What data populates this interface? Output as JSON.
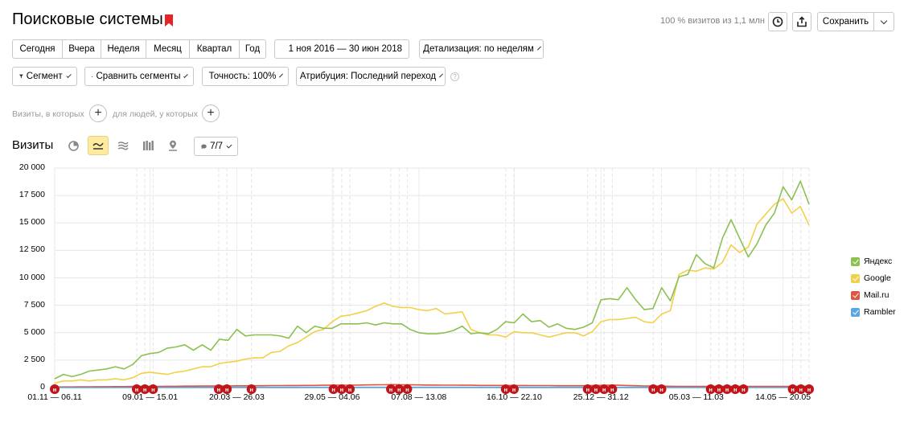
{
  "header": {
    "title": "Поисковые системы",
    "visits_total": "100 % визитов из 1,1 млн",
    "save_label": "Сохранить"
  },
  "period_buttons": [
    "Сегодня",
    "Вчера",
    "Неделя",
    "Месяц",
    "Квартал",
    "Год"
  ],
  "date_range": "1 ноя 2016 — 30 июн 2018",
  "detalization": "Детализация: по неделям",
  "filters": {
    "segment": "Сегмент",
    "compare": "Сравнить сегменты",
    "accuracy": "Точность: 100%",
    "attribution": "Атрибуция: Последний переход"
  },
  "conditions": {
    "visits_label": "Визиты, в которых",
    "people_label": "для людей, у которых"
  },
  "chart_panel": {
    "title": "Визиты",
    "annotations": "7/7"
  },
  "colors": {
    "yandex": "#8cc152",
    "google": "#f2d04a",
    "mailru": "#e0553f",
    "rambler": "#5aa6e0",
    "marker": "#c0161b"
  },
  "chart_data": {
    "type": "line",
    "ylim": [
      0,
      20000
    ],
    "yticks": [
      "20 000",
      "17 500",
      "15 000",
      "12 500",
      "10 000",
      "7 500",
      "5 000",
      "2 500",
      "0"
    ],
    "xtick_labels": [
      "01.11 — 06.11",
      "09.01 — 15.01",
      "20.03 — 26.03",
      "29.05 — 04.06",
      "07.08 — 13.08",
      "16.10 — 22.10",
      "25.12 — 31.12",
      "05.03 — 11.03",
      "14.05 — 20.05"
    ],
    "legend_position": "right",
    "series": [
      {
        "name": "Яндекс",
        "values": [
          800,
          1200,
          1000,
          1200,
          1500,
          1600,
          1700,
          1900,
          1700,
          2100,
          2900,
          3100,
          3200,
          3600,
          3700,
          3900,
          3400,
          3900,
          3400,
          4400,
          4300,
          5300,
          4700,
          4800,
          4800,
          4800,
          4700,
          4500,
          5600,
          5000,
          5600,
          5400,
          5400,
          5800,
          5800,
          5800,
          5900,
          5700,
          5900,
          5800,
          5800,
          5300,
          5000,
          4900,
          4900,
          5000,
          5200,
          5600,
          4900,
          5000,
          4900,
          5300,
          6000,
          5900,
          6700,
          6000,
          6100,
          5500,
          5800,
          5400,
          5300,
          5500,
          5900,
          8000,
          8100,
          8000,
          9100,
          8000,
          7100,
          7200,
          9100,
          7900,
          10100,
          10300,
          12100,
          11300,
          10900,
          13600,
          15300,
          13600,
          11900,
          13100,
          14800,
          15900,
          18300,
          17100,
          18800,
          16700
        ]
      },
      {
        "name": "Google",
        "values": [
          400,
          600,
          600,
          700,
          600,
          700,
          700,
          800,
          700,
          900,
          1300,
          1400,
          1300,
          1200,
          1400,
          1500,
          1700,
          1900,
          1900,
          2200,
          2300,
          2400,
          2600,
          2700,
          2700,
          3200,
          3300,
          3800,
          4100,
          4600,
          5100,
          5300,
          6000,
          6500,
          6600,
          6800,
          7000,
          7400,
          7700,
          7400,
          7300,
          7300,
          7100,
          7000,
          7200,
          6700,
          6800,
          6900,
          5300,
          5000,
          4800,
          4800,
          4600,
          5100,
          5000,
          5000,
          4800,
          4600,
          4800,
          5000,
          5000,
          4700,
          5100,
          6000,
          6200,
          6200,
          6300,
          6400,
          6000,
          5900,
          6700,
          7000,
          10300,
          10700,
          10600,
          10900,
          10800,
          11400,
          13000,
          12300,
          12800,
          14900,
          15800,
          16700,
          17200,
          15900,
          16500,
          14800
        ]
      },
      {
        "name": "Mail.ru",
        "values": [
          50,
          60,
          60,
          70,
          70,
          80,
          80,
          90,
          90,
          100,
          110,
          110,
          110,
          120,
          120,
          130,
          130,
          140,
          140,
          150,
          150,
          160,
          160,
          170,
          170,
          180,
          180,
          190,
          190,
          200,
          200,
          210,
          210,
          220,
          220,
          230,
          240,
          250,
          260,
          270,
          260,
          250,
          240,
          230,
          230,
          220,
          220,
          210,
          210,
          200,
          200,
          200,
          190,
          190,
          190,
          180,
          180,
          180,
          170,
          170,
          170,
          170,
          180,
          200,
          220,
          210,
          190,
          170,
          150,
          140,
          130,
          120,
          110,
          110,
          100,
          100,
          100,
          100,
          100,
          100,
          100,
          100,
          100,
          100,
          100,
          100,
          100,
          100
        ]
      },
      {
        "name": "Rambler",
        "values": [
          20,
          20,
          20,
          20,
          20,
          20,
          20,
          20,
          20,
          20,
          20,
          20,
          20,
          20,
          20,
          20,
          20,
          20,
          20,
          20,
          20,
          20,
          20,
          20,
          20,
          20,
          20,
          20,
          20,
          20,
          20,
          20,
          20,
          20,
          20,
          20,
          20,
          20,
          20,
          20,
          20,
          20,
          20,
          20,
          20,
          20,
          20,
          20,
          20,
          20,
          20,
          20,
          20,
          20,
          20,
          20,
          20,
          20,
          20,
          20,
          20,
          20,
          20,
          20,
          20,
          20,
          20,
          20,
          20,
          20,
          20,
          20,
          20,
          20,
          20,
          20,
          20,
          20,
          20,
          20,
          20,
          20,
          20,
          20,
          20,
          20,
          20,
          20
        ]
      }
    ],
    "marker_label": "н",
    "marker_weeks": [
      0,
      10,
      11,
      12,
      20,
      21,
      24,
      34,
      35,
      36,
      41,
      42,
      43,
      55,
      56,
      65,
      66,
      67,
      68,
      73,
      74,
      80,
      81,
      82,
      83,
      84,
      90,
      91,
      92
    ]
  }
}
